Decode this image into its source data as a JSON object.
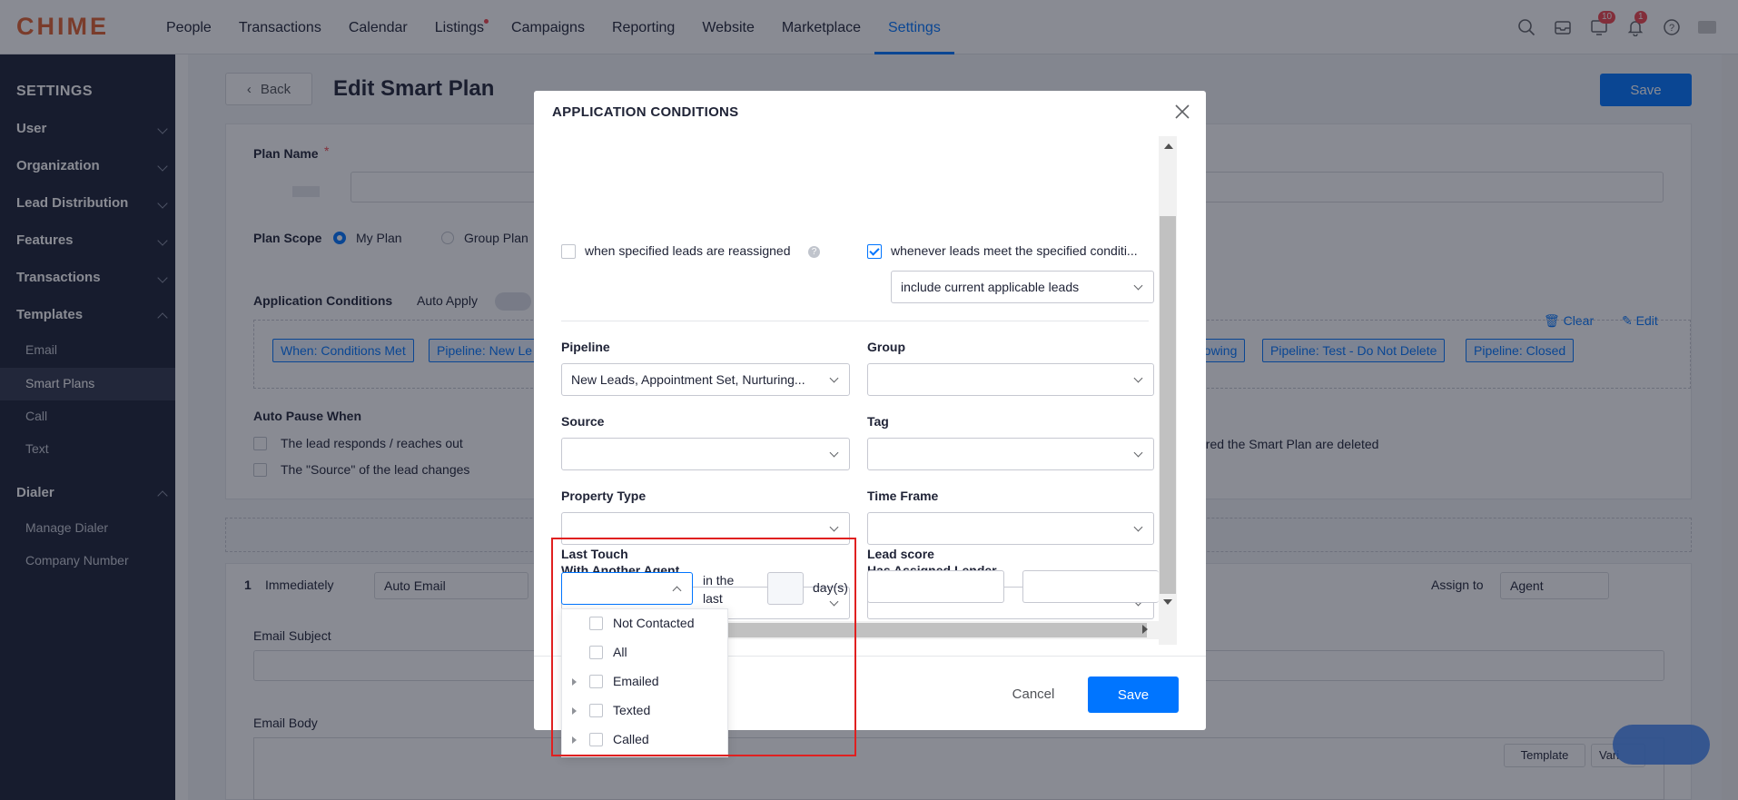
{
  "app": {
    "logo": "CHIME"
  },
  "nav": {
    "items": [
      {
        "label": "People"
      },
      {
        "label": "Transactions"
      },
      {
        "label": "Calendar"
      },
      {
        "label": "Listings"
      },
      {
        "label": "Campaigns"
      },
      {
        "label": "Reporting"
      },
      {
        "label": "Website"
      },
      {
        "label": "Marketplace"
      },
      {
        "label": "Settings"
      }
    ],
    "active": "Settings",
    "badges": {
      "tasks": "10",
      "notifications": "1"
    }
  },
  "sidebar": {
    "title": "SETTINGS",
    "groups": [
      {
        "label": "User"
      },
      {
        "label": "Organization"
      },
      {
        "label": "Lead Distribution"
      },
      {
        "label": "Features"
      },
      {
        "label": "Transactions"
      },
      {
        "label": "Templates"
      },
      {
        "label": "Dialer"
      }
    ],
    "template_items": [
      {
        "label": "Email"
      },
      {
        "label": "Smart Plans"
      },
      {
        "label": "Call"
      },
      {
        "label": "Text"
      }
    ],
    "dialer_items": [
      {
        "label": "Manage Dialer"
      },
      {
        "label": "Company Number"
      }
    ],
    "active_item": "Smart Plans"
  },
  "page": {
    "back_label": "Back",
    "title": "Edit Smart Plan",
    "save_label": "Save",
    "plan_name_label": "Plan Name",
    "plan_scope_label": "Plan Scope",
    "scope_options": [
      "My Plan",
      "Group Plan"
    ],
    "app_conditions_label": "Application Conditions",
    "auto_apply_label": "Auto Apply",
    "clear_label": "Clear",
    "edit_label": "Edit",
    "chips": [
      "When: Conditions Met",
      "Pipeline: New Le",
      "howing",
      "Pipeline: Test - Do Not Delete",
      "Pipeline: Closed"
    ],
    "auto_pause_label": "Auto Pause When",
    "auto_pause_options": [
      "The lead responds / reaches out",
      "The \"Source\" of the lead changes"
    ],
    "auto_pause_right": "ered the Smart Plan are deleted",
    "step_number": "1",
    "step_timing": "Immediately",
    "step_type": "Auto Email",
    "assign_label": "Assign to",
    "assign_value": "Agent",
    "email_subject_label": "Email Subject",
    "email_body_label": "Email Body",
    "template_label": "Template",
    "variable_label": "Vari"
  },
  "modal": {
    "title": "APPLICATION CONDITIONS",
    "trigger_reassigned": "when specified leads are reassigned",
    "trigger_conditions": "whenever leads meet the specified conditi...",
    "include_select": "include current applicable leads",
    "fields": {
      "pipeline": {
        "label": "Pipeline",
        "value": "New Leads, Appointment Set, Nurturing..."
      },
      "group": {
        "label": "Group",
        "value": ""
      },
      "source": {
        "label": "Source",
        "value": ""
      },
      "tag": {
        "label": "Tag",
        "value": ""
      },
      "property_type": {
        "label": "Property Type",
        "value": ""
      },
      "time_frame": {
        "label": "Time Frame",
        "value": ""
      },
      "with_another_agent": {
        "label": "With Another Agent",
        "value": ""
      },
      "has_assigned_lender": {
        "label": "Has Assigned Lender",
        "value": ""
      },
      "last_touch": {
        "label": "Last Touch",
        "value": "",
        "in_the_last": "in the last",
        "days": "day(s)"
      },
      "lead_score": {
        "label": "Lead score"
      }
    },
    "cancel_label": "Cancel",
    "save_label": "Save"
  },
  "dropdown": {
    "options": [
      {
        "label": "Not Contacted",
        "expandable": false
      },
      {
        "label": "All",
        "expandable": false
      },
      {
        "label": "Emailed",
        "expandable": true
      },
      {
        "label": "Texted",
        "expandable": true
      },
      {
        "label": "Called",
        "expandable": true
      }
    ]
  },
  "colors": {
    "accent": "#0075ff",
    "sidebar": "#1b2134",
    "logo": "#e0602e",
    "highlight": "#e02020"
  }
}
